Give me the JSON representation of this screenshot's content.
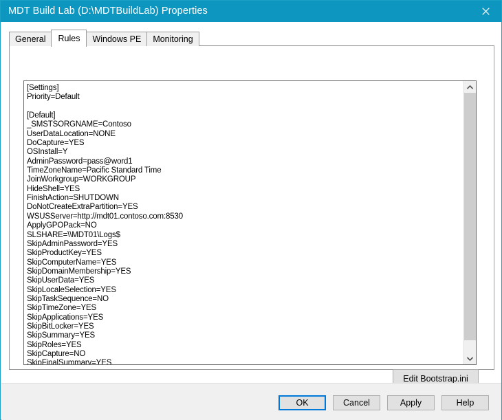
{
  "window": {
    "title": "MDT Build Lab (D:\\MDTBuildLab) Properties",
    "close_icon": "close-icon",
    "titlebar_color": "#0d96c0",
    "border_color": "#1ba1c5"
  },
  "tabs": [
    {
      "label": "General",
      "selected": false
    },
    {
      "label": "Rules",
      "selected": true
    },
    {
      "label": "Windows PE",
      "selected": false
    },
    {
      "label": "Monitoring",
      "selected": false
    }
  ],
  "rules_editor": {
    "name": "rules-textarea",
    "lines": [
      "[Settings]",
      "Priority=Default",
      "",
      "[Default]",
      "_SMSTSORGNAME=Contoso",
      "UserDataLocation=NONE",
      "DoCapture=YES",
      "OSInstall=Y",
      "AdminPassword=pass@word1",
      "TimeZoneName=Pacific Standard Time",
      "JoinWorkgroup=WORKGROUP",
      "HideShell=YES",
      "FinishAction=SHUTDOWN",
      "DoNotCreateExtraPartition=YES",
      "WSUSServer=http://mdt01.contoso.com:8530",
      "ApplyGPOPack=NO",
      "SLSHARE=\\\\MDT01\\Logs$",
      "SkipAdminPassword=YES",
      "SkipProductKey=YES",
      "SkipComputerName=YES",
      "SkipDomainMembership=YES",
      "SkipUserData=YES",
      "SkipLocaleSelection=YES",
      "SkipTaskSequence=NO",
      "SkipTimeZone=YES",
      "SkipApplications=YES",
      "SkipBitLocker=YES",
      "SkipSummary=YES",
      "SkipRoles=YES",
      "SkipCapture=NO",
      "SkipFinalSummary=YES"
    ]
  },
  "scrollbar": {
    "up_arrow_icon": "chevron-up-icon",
    "down_arrow_icon": "chevron-down-icon",
    "thumb_color": "#cdcdcd"
  },
  "panel_buttons": {
    "edit_bootstrap": "Edit Bootstrap.ini"
  },
  "footer_buttons": {
    "ok": "OK",
    "cancel": "Cancel",
    "apply": "Apply",
    "help": "Help",
    "focus_color": "#0078d7"
  }
}
